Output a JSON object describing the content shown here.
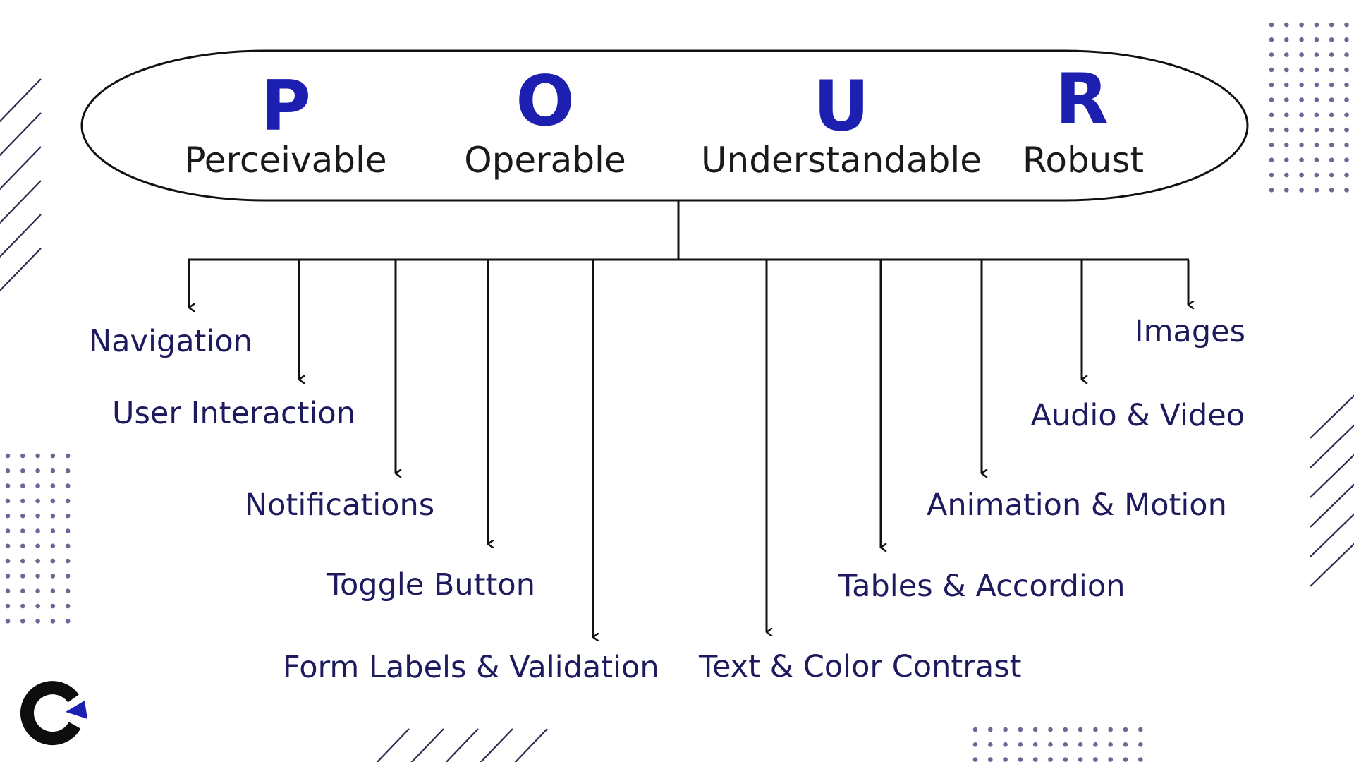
{
  "colors": {
    "accent": "#1c1fb0",
    "label": "#1e1a5e",
    "line": "#111111",
    "dots": "#6b6796",
    "slashes": "#2a2a4e",
    "logo_dark": "#0d0d0d"
  },
  "header": {
    "principles": [
      {
        "letter": "P",
        "word": "Perceivable"
      },
      {
        "letter": "O",
        "word": "Operable"
      },
      {
        "letter": "U",
        "word": "Understandable"
      },
      {
        "letter": "R",
        "word": "Robust"
      }
    ]
  },
  "branches": [
    {
      "label": "Navigation"
    },
    {
      "label": "User Interaction"
    },
    {
      "label": "Notifications"
    },
    {
      "label": "Toggle Button"
    },
    {
      "label": "Form Labels & Validation"
    },
    {
      "label": "Text & Color Contrast"
    },
    {
      "label": "Tables & Accordion"
    },
    {
      "label": "Animation & Motion"
    },
    {
      "label": "Audio & Video"
    },
    {
      "label": "Images"
    }
  ],
  "logo": {
    "icon": "brand-logo-icon"
  }
}
